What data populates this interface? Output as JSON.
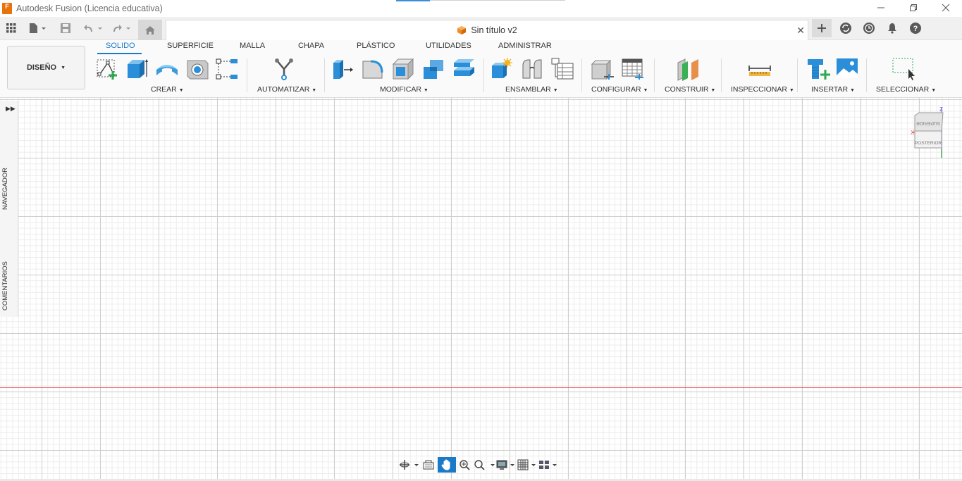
{
  "app": {
    "logo_letter": "F",
    "title": "Autodesk Fusion (Licencia educativa)",
    "window_controls": [
      "minimize",
      "restore",
      "close"
    ]
  },
  "quick_access": {
    "icons": [
      "grid-apps-icon",
      "file-icon",
      "save-icon",
      "undo-icon",
      "redo-icon",
      "home-icon",
      "new-tab-icon",
      "sync-icon",
      "history-icon",
      "bell-icon",
      "help-icon"
    ]
  },
  "document": {
    "title": "Sin título v2"
  },
  "ribbon": {
    "workspace": "DISEÑO",
    "tabs": [
      "SOLIDO",
      "SUPERFICIE",
      "MALLA",
      "CHAPA",
      "PLÁSTICO",
      "UTILIDADES",
      "ADMINISTRAR"
    ],
    "active_tab": "SOLIDO",
    "groups": [
      "CREAR",
      "AUTOMATIZAR",
      "MODIFICAR",
      "ENSAMBLAR",
      "CONFIGURAR",
      "CONSTRUIR",
      "INSPECCIONAR",
      "INSERTAR",
      "SELECCIONAR"
    ]
  },
  "side_panel": {
    "navigator": "NAVEGADOR",
    "comments": "COMENTARIOS"
  },
  "viewcube": {
    "top_face": "SUPERIOR",
    "front_face": "POSTERIOR",
    "axis_x": "X",
    "axis_z": "Z"
  },
  "colors": {
    "accent": "#1a7ac8",
    "origin_axis": "#e06060",
    "brand": "#e8730a"
  }
}
